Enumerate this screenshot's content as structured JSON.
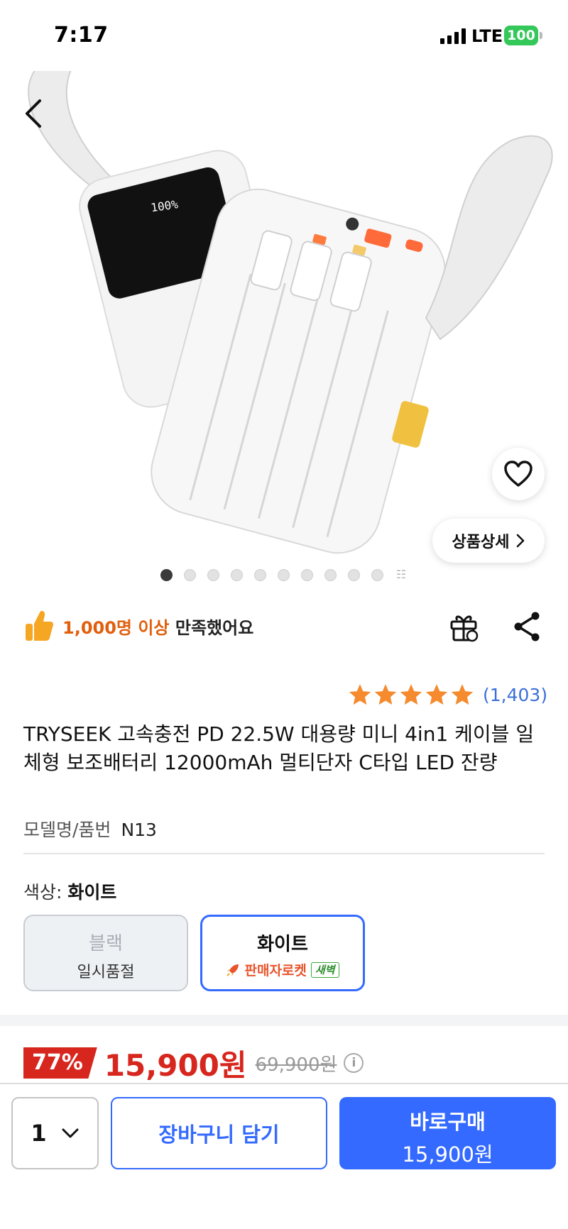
{
  "status_bar": {
    "time": "7:17",
    "network": "LTE",
    "battery": "100"
  },
  "gallery": {
    "detail_button": "상품상세",
    "image_count": 10,
    "active_index": 0
  },
  "satisfaction": {
    "highlight": "1,000명 이상",
    "text": " 만족했어요"
  },
  "rating": {
    "stars": 5,
    "count": "(1,403)"
  },
  "product": {
    "title": "TRYSEEK 고속충전 PD 22.5W 대용량 미니 4in1 케이블 일체형 보조배터리 12000mAh 멀티단자 C타입 LED 잔량",
    "model_label": "모델명/품번",
    "model_value": "N13"
  },
  "color": {
    "label": "색상: ",
    "selected": "화이트",
    "options": [
      {
        "name": "블랙",
        "sub": "일시품절"
      },
      {
        "name": "화이트",
        "seller": "판매자로켓",
        "badge": "새벽"
      }
    ]
  },
  "price": {
    "discount": "77%",
    "sale": "15,900원",
    "original": "69,900원"
  },
  "bottom": {
    "quantity": "1",
    "cart_label": "장바구니 담기",
    "buy_label": "바로구매",
    "buy_price": "15,900원"
  },
  "colors": {
    "accent": "#346aff",
    "sale_red": "#d7261e",
    "rating_orange": "#f58a2e",
    "highlight_orange": "#e0600e"
  },
  "icons": [
    "back-icon",
    "heart-icon",
    "chevron-right-icon",
    "thumbs-up-icon",
    "gift-icon",
    "share-icon",
    "star-icon",
    "rocket-icon",
    "info-icon",
    "chevron-down-icon"
  ]
}
